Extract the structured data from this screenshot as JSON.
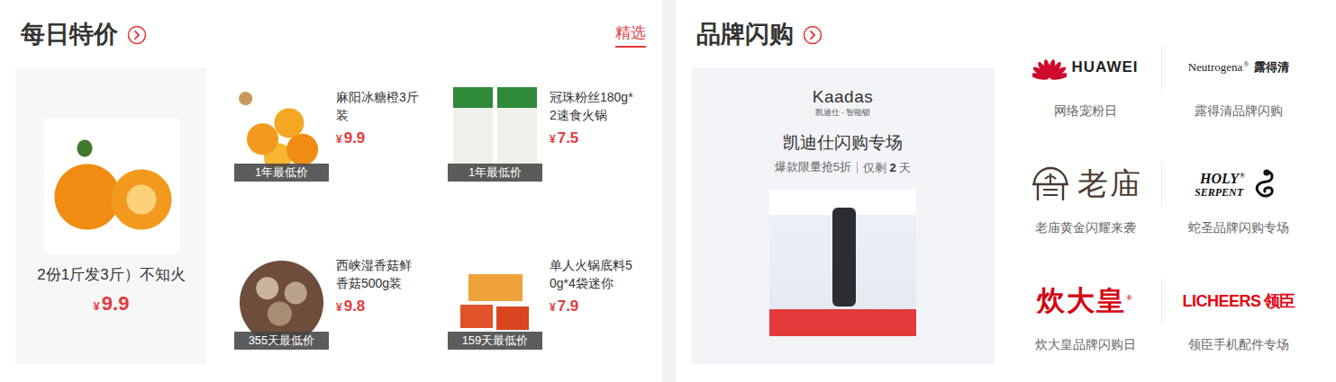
{
  "daily_deals": {
    "title": "每日特价",
    "tabs": [
      {
        "label": "精选",
        "selected": true
      }
    ],
    "featured": {
      "name": "2份1斤发3斤）不知火",
      "currency": "¥",
      "price": "9.9"
    },
    "items": [
      {
        "name": "麻阳冰糖橙3斤装",
        "currency": "¥",
        "price": "9.9",
        "badge": "1年最低价"
      },
      {
        "name": "冠珠粉丝180g*2速食火锅",
        "currency": "¥",
        "price": "7.5",
        "badge": "1年最低价"
      },
      {
        "name": "西峡湿香菇鲜香菇500g装",
        "currency": "¥",
        "price": "9.8",
        "badge": "355天最低价"
      },
      {
        "name": "单人火锅底料50g*4袋迷你",
        "currency": "¥",
        "price": "7.9",
        "badge": "159天最低价"
      }
    ]
  },
  "brand_flash": {
    "title": "品牌闪购",
    "promo": {
      "logo": "Kaadas",
      "logo_sub": "凯迪仕 · 智能锁",
      "title": "凯迪仕闪购专场",
      "offer": "爆款限量抢5折",
      "remaining_prefix": "仅剩",
      "remaining_days": "2",
      "remaining_suffix": "天"
    },
    "brands": [
      {
        "kind": "huawei",
        "logo": [
          "HUAWEI"
        ],
        "caption": "网络宠粉日"
      },
      {
        "kind": "neutrogena",
        "logo": [
          "Neutrogena",
          "露得清"
        ],
        "mark": "®",
        "caption": "露得清品牌闪购"
      },
      {
        "kind": "laomiao",
        "logo": [
          "老庙"
        ],
        "caption": "老庙黄金闪耀来袭"
      },
      {
        "kind": "serpent",
        "logo": [
          "HOLY",
          "SERPENT"
        ],
        "mark": "®",
        "caption": "蛇圣品牌闪购专场"
      },
      {
        "kind": "chuidahuang",
        "logo": [
          "炊大皇"
        ],
        "mark": "®",
        "caption": "炊大皇品牌闪购日"
      },
      {
        "kind": "licheers",
        "logo": [
          "LICHEERS",
          "领臣"
        ],
        "caption": "领臣手机配件专场"
      }
    ]
  }
}
